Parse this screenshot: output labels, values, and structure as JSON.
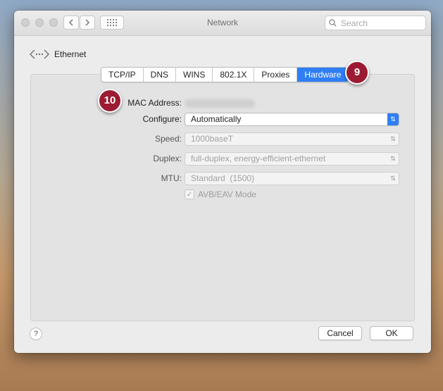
{
  "window": {
    "title": "Network"
  },
  "search": {
    "placeholder": "Search"
  },
  "location": {
    "label": "Ethernet"
  },
  "tabs": [
    {
      "label": "TCP/IP"
    },
    {
      "label": "DNS"
    },
    {
      "label": "WINS"
    },
    {
      "label": "802.1X"
    },
    {
      "label": "Proxies"
    },
    {
      "label": "Hardware",
      "active": true
    }
  ],
  "hardware": {
    "mac_label": "MAC Address:",
    "configure_label": "Configure:",
    "configure_value": "Automatically",
    "speed_label": "Speed:",
    "speed_value": "1000baseT",
    "duplex_label": "Duplex:",
    "duplex_value": "full-duplex, energy-efficient-ethernet",
    "mtu_label": "MTU:",
    "mtu_value": "Standard  (1500)",
    "avb_label": "AVB/EAV Mode",
    "avb_checked": true
  },
  "footer": {
    "help": "?",
    "cancel": "Cancel",
    "ok": "OK"
  },
  "annotations": {
    "badge_tabs": "9",
    "badge_mac": "10"
  },
  "colors": {
    "accent": "#2f7ef5",
    "badge": "#9b1b32"
  }
}
